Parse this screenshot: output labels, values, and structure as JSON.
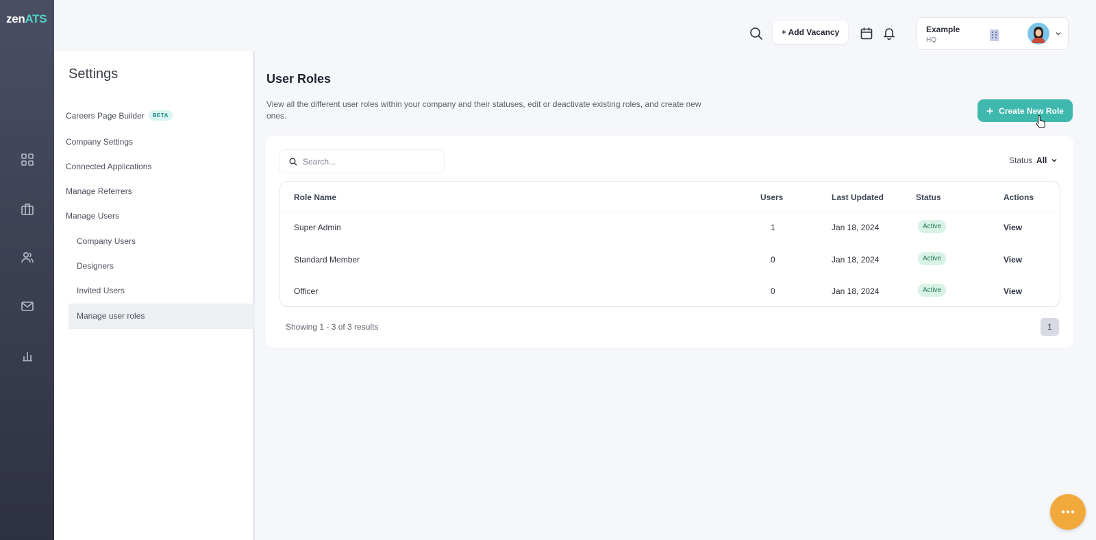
{
  "app": {
    "logo_main": "zen",
    "logo_accent": "ATS"
  },
  "rail": {
    "items": [
      "grid-icon",
      "briefcase-icon",
      "users-icon",
      "mail-icon",
      "chart-icon"
    ]
  },
  "topbar": {
    "add_vacancy_label": "+ Add Vacancy",
    "company_name": "Example",
    "company_sub": "HQ"
  },
  "settings": {
    "title": "Settings",
    "items": [
      {
        "label": "Careers Page Builder",
        "badge": "BETA"
      },
      {
        "label": "Company Settings"
      },
      {
        "label": "Connected Applications"
      },
      {
        "label": "Manage Referrers"
      },
      {
        "label": "Manage Users"
      },
      {
        "label": "Company Users"
      },
      {
        "label": "Designers"
      },
      {
        "label": "Invited Users"
      },
      {
        "label": "Manage user roles",
        "active": true
      }
    ]
  },
  "main": {
    "title": "User Roles",
    "description": "View all the different user roles within your company and their statuses, edit or deactivate existing roles, and create new ones.",
    "create_label": "Create New Role",
    "search_placeholder": "Search...",
    "status_label": "Status",
    "status_value": "All",
    "table": {
      "headers": [
        "Role Name",
        "Users",
        "Last Updated",
        "Status",
        "Actions"
      ],
      "rows": [
        {
          "name": "Super Admin",
          "users": "1",
          "updated": "Jan 18, 2024",
          "status": "Active",
          "action": "View"
        },
        {
          "name": "Standard Member",
          "users": "0",
          "updated": "Jan 18, 2024",
          "status": "Active",
          "action": "View"
        },
        {
          "name": "Officer",
          "users": "0",
          "updated": "Jan 18, 2024",
          "status": "Active",
          "action": "View"
        }
      ]
    },
    "showing": "Showing 1 - 3 of 3 results",
    "page": "1"
  },
  "colors": {
    "accent": "#3fb8ad",
    "active_badge_bg": "#d8f3e6",
    "fab": "#f2a93b"
  }
}
